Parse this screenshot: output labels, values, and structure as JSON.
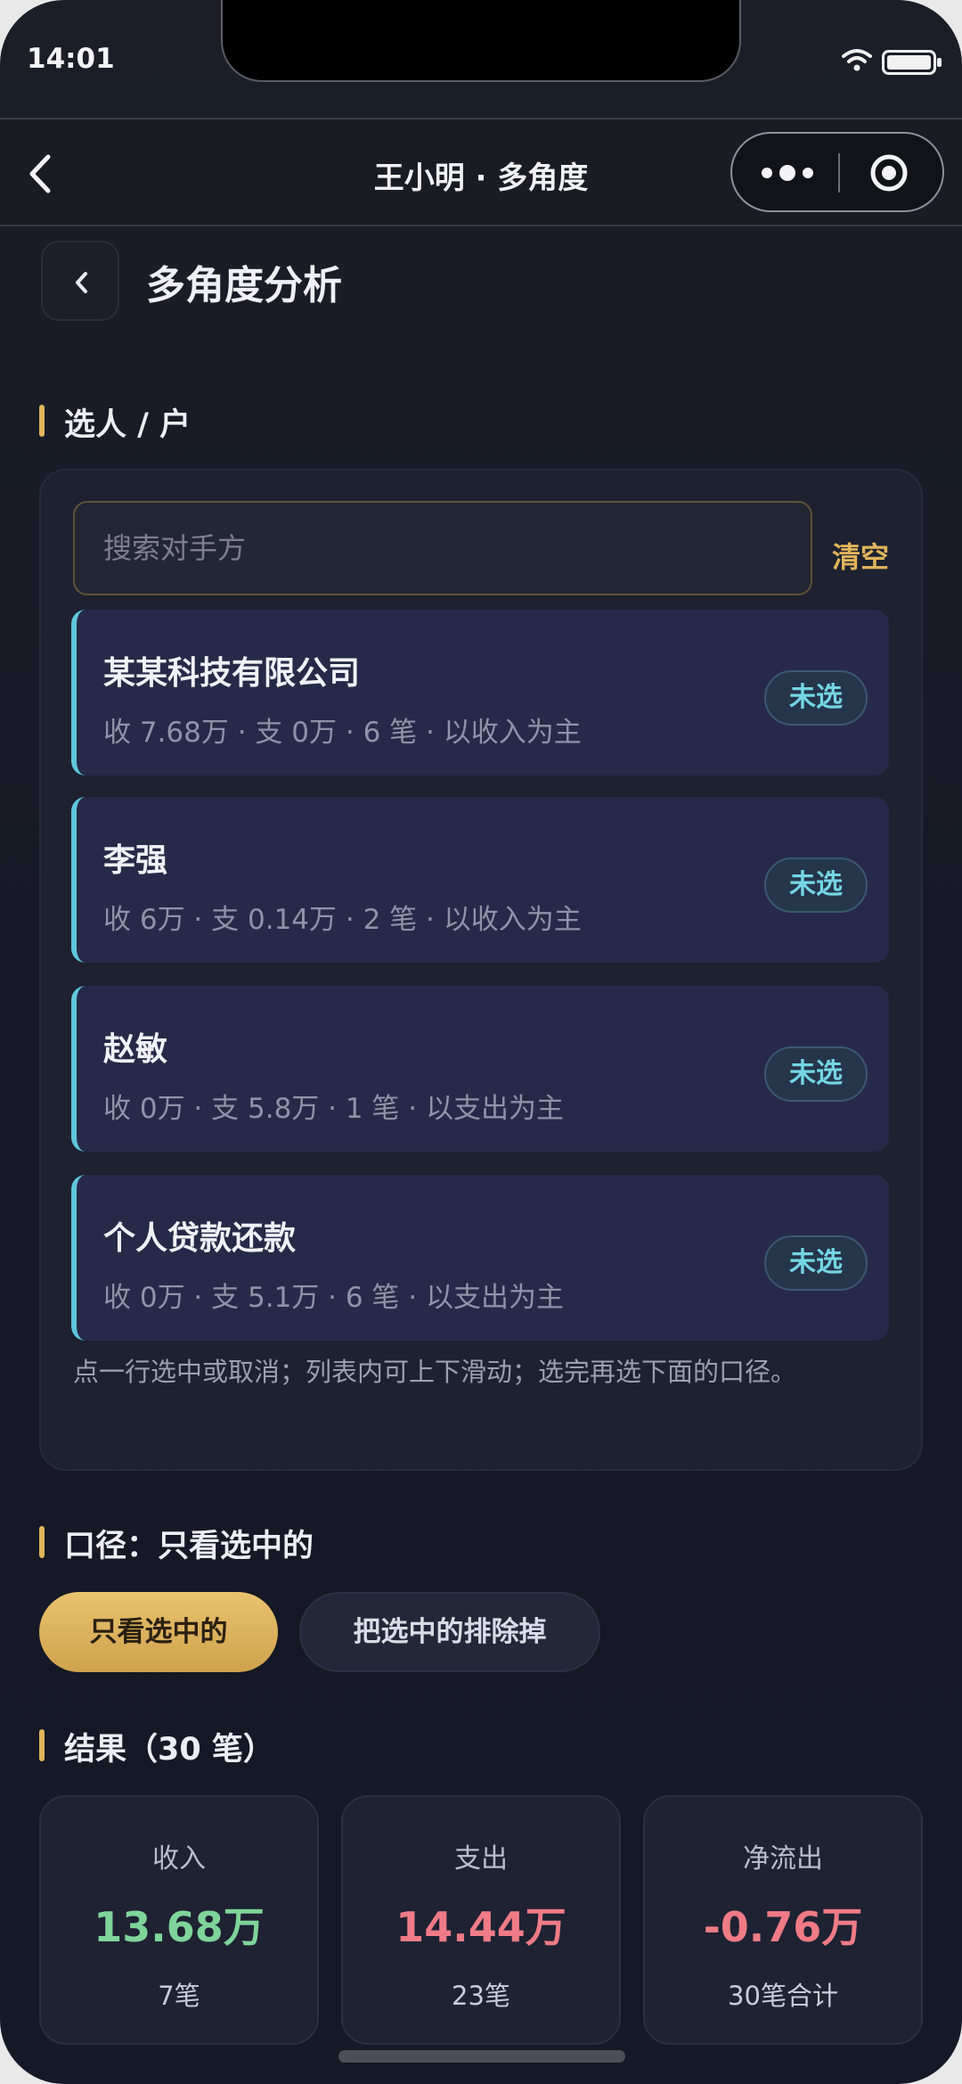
{
  "status": {
    "time": "14:01"
  },
  "nav": {
    "title": "王小明 · 多角度"
  },
  "header": {
    "title": "多角度分析"
  },
  "sections": {
    "select": "选人 / 户",
    "scope": "口径：只看选中的",
    "result": "结果（30 笔）"
  },
  "search": {
    "placeholder": "搜索对手方",
    "value": "",
    "clear_label": "清空"
  },
  "list": {
    "items": [
      {
        "name": "某某科技有限公司",
        "meta": "收 7.68万 · 支 0万 · 6 笔 · 以收入为主",
        "badge": "未选"
      },
      {
        "name": "李强",
        "meta": "收 6万 · 支 0.14万 · 2 笔 · 以收入为主",
        "badge": "未选"
      },
      {
        "name": "赵敏",
        "meta": "收 0万 · 支 5.8万 · 1 笔 · 以支出为主",
        "badge": "未选"
      },
      {
        "name": "个人贷款还款",
        "meta": "收 0万 · 支 5.1万 · 6 笔 · 以支出为主",
        "badge": "未选"
      }
    ],
    "hint": "点一行选中或取消；列表内可上下滑动；选完再选下面的口径。"
  },
  "scope": {
    "options": [
      "只看选中的",
      "把选中的排除掉"
    ],
    "selected": "只看选中的"
  },
  "results": {
    "income": {
      "label": "收入",
      "value": "13.68万",
      "sub": "7笔",
      "color": "#7fd49a"
    },
    "expense": {
      "label": "支出",
      "value": "14.44万",
      "sub": "23笔",
      "color": "#ef7b86"
    },
    "net": {
      "label": "净流出",
      "value": "-0.76万",
      "sub": "30笔合计",
      "color": "#ef7b86"
    }
  },
  "colors": {
    "accent": "#e0b45a",
    "teal": "#5ec7d9",
    "background": "#161925"
  }
}
